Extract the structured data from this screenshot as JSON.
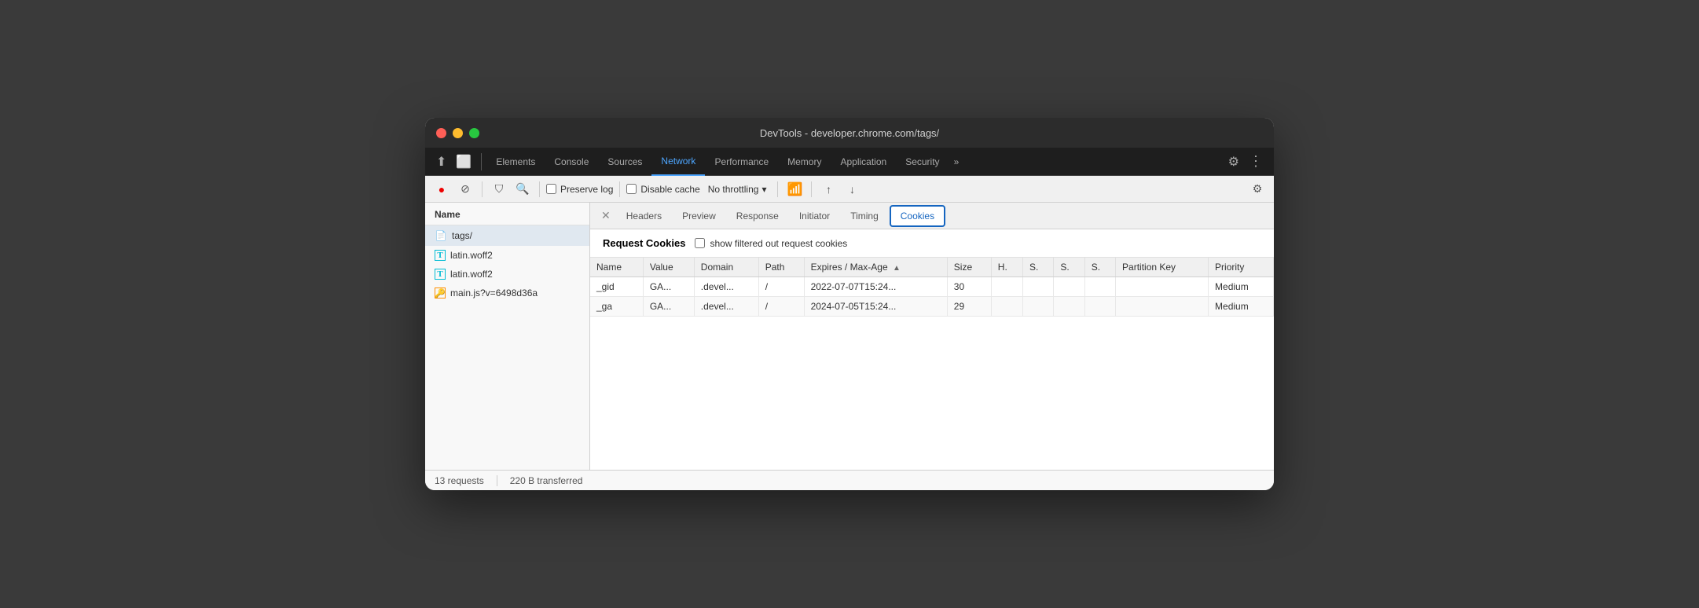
{
  "window": {
    "title": "DevTools - developer.chrome.com/tags/"
  },
  "traffic_lights": {
    "close": "close",
    "minimize": "minimize",
    "maximize": "maximize"
  },
  "devtools": {
    "tabs": [
      {
        "label": "Elements",
        "active": false
      },
      {
        "label": "Console",
        "active": false
      },
      {
        "label": "Sources",
        "active": false
      },
      {
        "label": "Network",
        "active": true
      },
      {
        "label": "Performance",
        "active": false
      },
      {
        "label": "Memory",
        "active": false
      },
      {
        "label": "Application",
        "active": false
      },
      {
        "label": "Security",
        "active": false
      }
    ],
    "more_tabs_label": "»",
    "settings_icon": "⚙",
    "more_icon": "⋮"
  },
  "toolbar": {
    "record_btn": "●",
    "stop_btn": "⊘",
    "filter_btn": "⛉",
    "search_btn": "🔍",
    "preserve_log": "Preserve log",
    "disable_cache": "Disable cache",
    "throttling_label": "No throttling",
    "throttling_arrow": "▾",
    "wifi_icon": "wifi",
    "upload_icon": "upload",
    "download_icon": "download",
    "settings_icon": "⚙"
  },
  "file_list": {
    "header": "Name",
    "items": [
      {
        "name": "tags/",
        "icon_type": "page",
        "selected": true
      },
      {
        "name": "latin.woff2",
        "icon_type": "font-cyan"
      },
      {
        "name": "latin.woff2",
        "icon_type": "font-cyan"
      },
      {
        "name": "main.js?v=6498d36a",
        "icon_type": "script-yellow"
      }
    ]
  },
  "status_bar": {
    "requests": "13 requests",
    "transferred": "220 B transferred"
  },
  "detail_panel": {
    "tabs": [
      {
        "label": "Headers",
        "active": false
      },
      {
        "label": "Preview",
        "active": false
      },
      {
        "label": "Response",
        "active": false
      },
      {
        "label": "Initiator",
        "active": false
      },
      {
        "label": "Timing",
        "active": false
      },
      {
        "label": "Cookies",
        "active": true
      }
    ]
  },
  "cookies": {
    "request_cookies_title": "Request Cookies",
    "show_filtered_label": "show filtered out request cookies",
    "table_headers": [
      "Name",
      "Value",
      "Domain",
      "Path",
      "Expires / Max-Age",
      "Size",
      "H.",
      "S.",
      "S.",
      "S.",
      "Partition Key",
      "Priority"
    ],
    "rows": [
      {
        "name": "_gid",
        "value": "GA...",
        "domain": ".devel...",
        "path": "/",
        "expires": "2022-07-07T15:24...",
        "size": "30",
        "h": "",
        "s1": "",
        "s2": "",
        "s3": "",
        "partition_key": "",
        "priority": "Medium"
      },
      {
        "name": "_ga",
        "value": "GA...",
        "domain": ".devel...",
        "path": "/",
        "expires": "2024-07-05T15:24...",
        "size": "29",
        "h": "",
        "s1": "",
        "s2": "",
        "s3": "",
        "partition_key": "",
        "priority": "Medium"
      }
    ]
  }
}
